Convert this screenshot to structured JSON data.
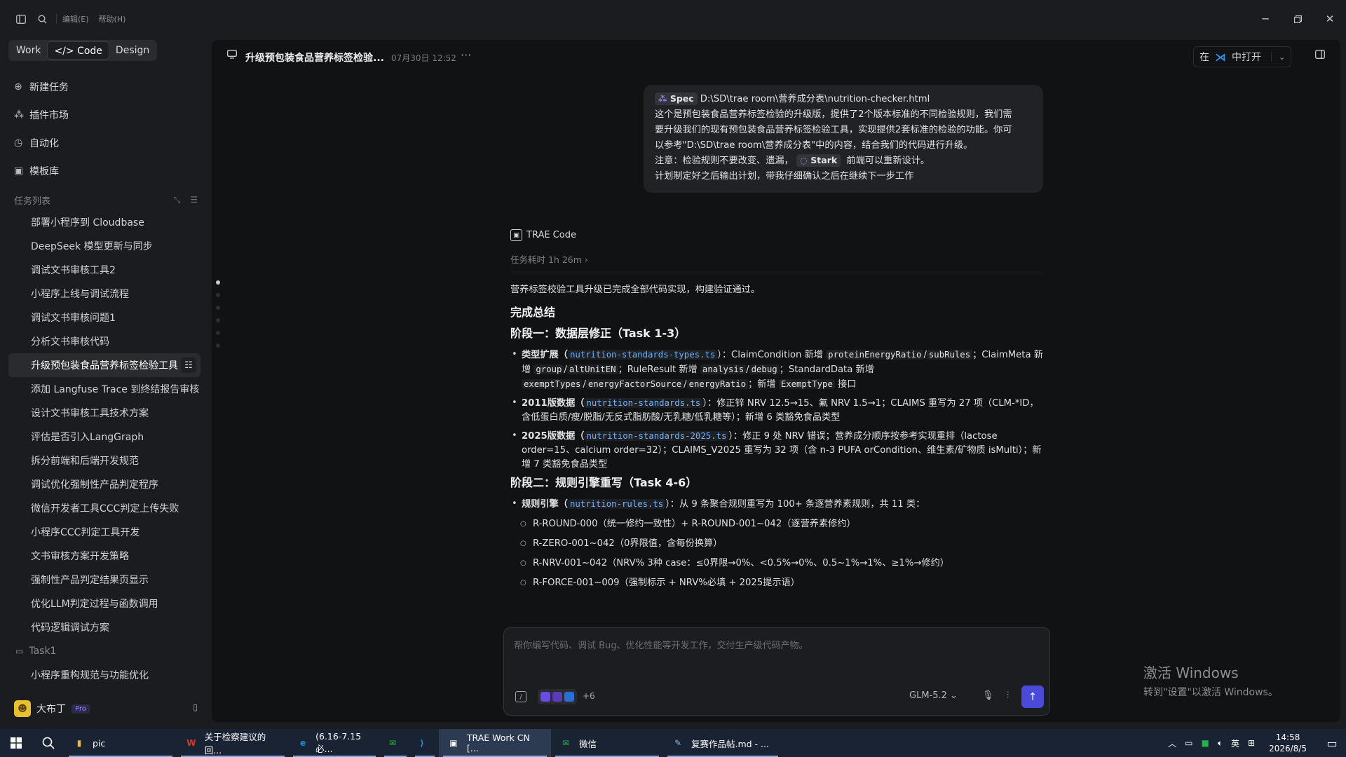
{
  "titlebar": {
    "menu_edit": "编辑(E)",
    "menu_help": "帮助(H)"
  },
  "sidebar": {
    "modes": [
      "Work",
      "</> Code",
      "Design"
    ],
    "nav": [
      {
        "label": "新建任务",
        "icon": "new-task-icon"
      },
      {
        "label": "插件市场",
        "icon": "plugin-market-icon"
      },
      {
        "label": "自动化",
        "icon": "automation-icon"
      },
      {
        "label": "模板库",
        "icon": "template-library-icon"
      }
    ],
    "section_title": "任务列表",
    "tasks": [
      "部署小程序到 Cloudbase",
      "DeepSeek 模型更新与同步",
      "调试文书审核工具2",
      "小程序上线与调试流程",
      "调试文书审核问题1",
      "分析文书审核代码",
      "升级预包装食品营养标签检验工具",
      "添加 Langfuse Trace 到终结报告审核",
      "设计文书审核工具技术方案",
      "评估是否引入LangGraph",
      "拆分前端和后端开发规范",
      "调试优化强制性产品判定程序",
      "微信开发者工具CCC判定上传失败",
      "小程序CCC判定工具开发",
      "文书审核方案开发策略",
      "强制性产品判定结果页显示",
      "优化LLM判定过程与函数调用",
      "代码逻辑调试方案"
    ],
    "active_task_index": 6,
    "folder": "Task1",
    "folder_task": "小程序重构规范与功能优化",
    "user": {
      "avatar": "☻",
      "name": "大布丁",
      "badge": "Pro"
    }
  },
  "header": {
    "title": "升级预包装食品营养标签检验...",
    "time": "07月30日 12:52",
    "open_prefix": "在",
    "open_label": "中打开"
  },
  "user_message": {
    "chip_label": "Spec",
    "line1_path": "D:\\SD\\trae room\\营养成分表\\nutrition-checker.html",
    "line2": "这个是预包装食品营养标签检验的升级版，提供了2个版本标准的不同检验规则，我们需",
    "line3": "要升级我们的现有预包装食品营养标签检验工具，实现提供2套标准的检验的功能。你可",
    "line4": "以参考\"D:\\SD\\trae room\\营养成分表\"中的内容，结合我们的代码进行升级。",
    "line5_a": "注意：检验规则不要改变、遗漏，",
    "line5_chip": "Stark",
    "line5_b": "前端可以重新设计。",
    "line6": "计划制定好之后输出计划，带我仔细确认之后在继续下一步工作"
  },
  "assistant": {
    "name": "TRAE Code",
    "duration": "任务耗时 1h 26m",
    "intro": "营养标签校验工具升级已完成全部代码实现，构建验证通过。",
    "h_summary": "完成总结",
    "h_stage1": "阶段一：数据层修正（Task 1-3）",
    "s1_b1": {
      "p1": "类型扩展（",
      "f": "nutrition-standards-types.ts",
      "p2": "）：ClaimCondition 新增 ",
      "c1": "proteinEnergyRatio",
      "sep1": "/",
      "c2": "subRules",
      "p3": "；ClaimMeta 新增 ",
      "c3": "group",
      "sep2": "/",
      "c4": "altUnitEN",
      "p4": "；RuleResult 新增 ",
      "c5": "analysis",
      "sep3": "/",
      "c6": "debug",
      "p5": "；StandardData 新增 ",
      "c7": "exemptTypes",
      "sep4": "/",
      "c8": "energyFactorSource",
      "sep5": "/",
      "c9": "energyRatio",
      "p6": "；新增 ",
      "c10": "ExemptType",
      "p7": " 接口"
    },
    "s1_b2": {
      "p1": "2011版数据（",
      "f": "nutrition-standards.ts",
      "p2": "）：修正锌 NRV 12.5→15、氟 NRV 1.5→1；CLAIMS 重写为 27 项（CLM-*ID，含低蛋白质/瘦/脱脂/无反式脂肪酸/无乳糖/低乳糖等）；新增 6 类豁免食品类型"
    },
    "s1_b3": {
      "p1": "2025版数据（",
      "f": "nutrition-standards-2025.ts",
      "p2": "）：修正 9 处 NRV 错误；营养成分顺序按参考实现重排（lactose order=15、calcium order=32）；CLAIMS_V2025 重写为 32 项（含 n-3 PUFA orCondition、维生素/矿物质 isMulti）；新增 7 类豁免食品类型"
    },
    "h_stage2": "阶段二：规则引擎重写（Task 4-6）",
    "s2_b1": {
      "p1": "规则引擎（",
      "f": "nutrition-rules.ts",
      "p2": "）：从 9 条聚合规则重写为 100+ 条逐营养素规则，共 11 类："
    },
    "s2_sub": [
      "R-ROUND-000（统一修约一致性）+ R-ROUND-001~042（逐营养素修约）",
      "R-ZERO-001~042（0界限值，含每份换算）",
      "R-NRV-001~042（NRV% 3种 case：≤0界限→0%、<0.5%→0%、0.5~1%→1%、≥1%→修约）",
      "R-FORCE-001~009（强制标示 + NRV%必填 + 2025提示语）"
    ]
  },
  "composer": {
    "placeholder": "帮你编写代码、调试 Bug、优化性能等开发工作，交付生产级代码产物。",
    "more_count": "+6",
    "model": "GLM-5.2"
  },
  "watermark": {
    "line1": "激活 Windows",
    "line2": "转到\"设置\"以激活 Windows。"
  },
  "taskbar": {
    "items": [
      {
        "label": "pic",
        "color": "#e9b949",
        "glyph": "▮"
      },
      {
        "label": "关于检察建议的回...",
        "color": "#d23a2a",
        "glyph": "W"
      },
      {
        "label": "(6.16-7.15必...",
        "color": "#1d8cd8",
        "glyph": "e"
      },
      {
        "label": "",
        "color": "#22b24c",
        "glyph": "✉"
      },
      {
        "label": "",
        "color": "#2b8fe0",
        "glyph": "⟩"
      },
      {
        "label": "TRAE Work CN [...",
        "color": "#ffffff",
        "glyph": "▣"
      },
      {
        "label": "微信",
        "color": "#22b24c",
        "glyph": "✉"
      },
      {
        "label": "复赛作品帖.md - ...",
        "color": "#8fb3e6",
        "glyph": "✎"
      }
    ],
    "ime": "英",
    "time": "14:58",
    "date": "2026/8/5"
  },
  "colors": {
    "accent": "#4a4ad9",
    "link": "#6fb2ff",
    "pro": "#8f8bff"
  }
}
